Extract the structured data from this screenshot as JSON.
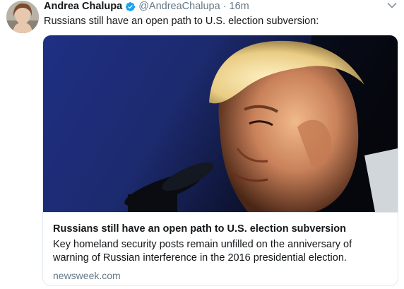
{
  "tweet": {
    "author_name": "Andrea Chalupa",
    "handle": "@AndreaChalupa",
    "separator": "·",
    "time": "16m",
    "text": "Russians still have an open path to U.S. election subversion:",
    "avatar_icon": "avatar-photo",
    "verified_icon": "verified-badge-icon",
    "menu_icon": "chevron-down-icon"
  },
  "card": {
    "image_icon": "portrait-photo",
    "title": "Russians still have an open path to U.S. election subversion",
    "description": "Key homeland security posts remain unfilled on the anniversary of warning of Russian interference in the 2016 presidential election.",
    "domain": "newsweek.com"
  },
  "colors": {
    "text": "#14171a",
    "secondary": "#657786",
    "verified": "#1da1f2",
    "border": "#e1e8ed"
  }
}
